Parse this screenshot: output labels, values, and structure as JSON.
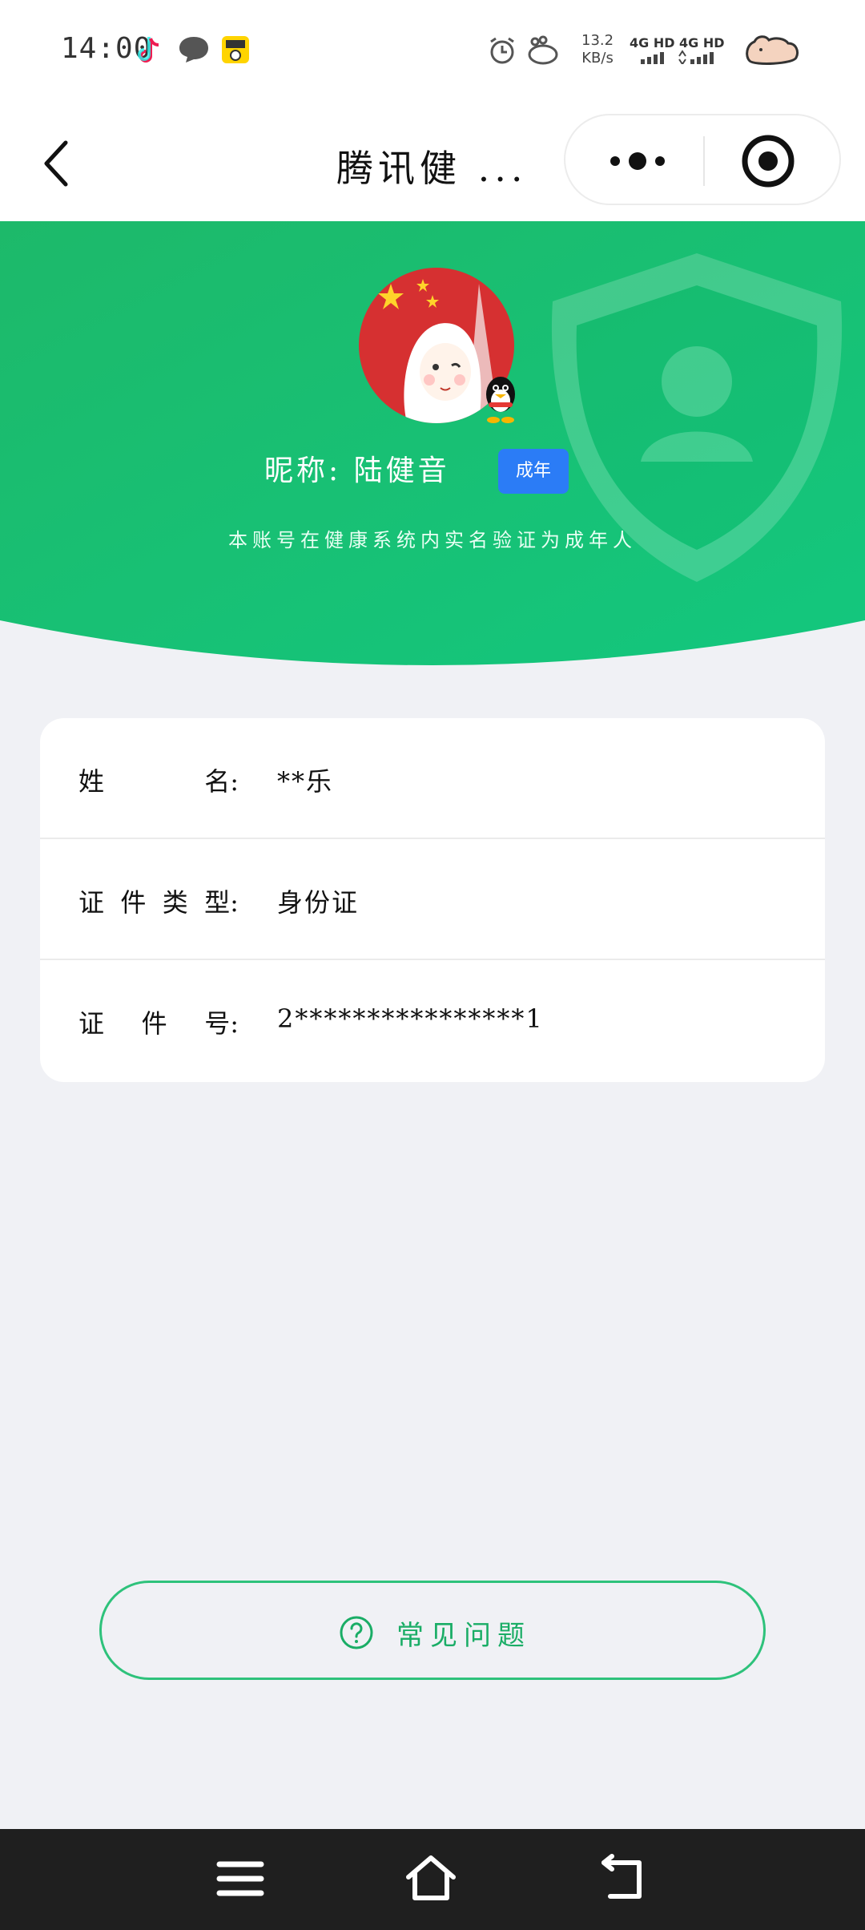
{
  "status_bar": {
    "time": "14:00",
    "net_speed_value": "13.2",
    "net_speed_unit": "KB/s",
    "signal_1": "4G HD",
    "signal_2": "4G HD",
    "icons": [
      "tiktok-icon",
      "message-icon",
      "app-icon",
      "alarm-icon",
      "hippo-icon",
      "signal-icon",
      "battery-icon"
    ]
  },
  "nav": {
    "title": "腾讯健 ..."
  },
  "profile": {
    "nickname": "昵称: 陆健音",
    "adult_badge": "成年",
    "verify_text": "本账号在健康系统内实名验证为成年人"
  },
  "info": {
    "rows": [
      {
        "label_chars": [
          "姓",
          "名:"
        ],
        "value": "**乐"
      },
      {
        "label_chars": [
          "证",
          "件",
          "类",
          "型:"
        ],
        "value": "身份证"
      },
      {
        "label_chars": [
          "证",
          "件",
          "号:"
        ],
        "value": "2****************1"
      }
    ]
  },
  "faq": {
    "label": "常见问题"
  },
  "colors": {
    "accent_green": "#1aad66",
    "hero_green": "#17c173",
    "badge_blue": "#2b7cf6"
  }
}
